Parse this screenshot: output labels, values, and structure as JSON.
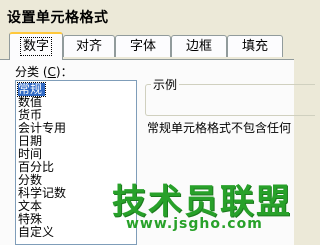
{
  "window": {
    "title": "设置单元格格式"
  },
  "tabs": [
    {
      "label": "数字",
      "active": true
    },
    {
      "label": "对齐",
      "active": false
    },
    {
      "label": "字体",
      "active": false
    },
    {
      "label": "边框",
      "active": false
    },
    {
      "label": "填充",
      "active": false
    }
  ],
  "category": {
    "label_prefix": "分类 (",
    "label_key": "C",
    "label_suffix": ")：",
    "items": [
      "常规",
      "数值",
      "货币",
      "会计专用",
      "日期",
      "时间",
      "百分比",
      "分数",
      "科学记数",
      "文本",
      "特殊",
      "自定义"
    ],
    "selected": "常规"
  },
  "sample": {
    "group_title": "示例",
    "description": "常规单元格格式不包含任何"
  },
  "watermark": {
    "text": "技术员联盟",
    "url": "www.jsgho.com"
  },
  "colors": {
    "dialog_bg": "#ece9d8",
    "panel_bg": "#fbfbfb",
    "selection": "#316ac5",
    "active_tab_accent": "#ffc83c",
    "watermark_green": "#28a12a"
  }
}
